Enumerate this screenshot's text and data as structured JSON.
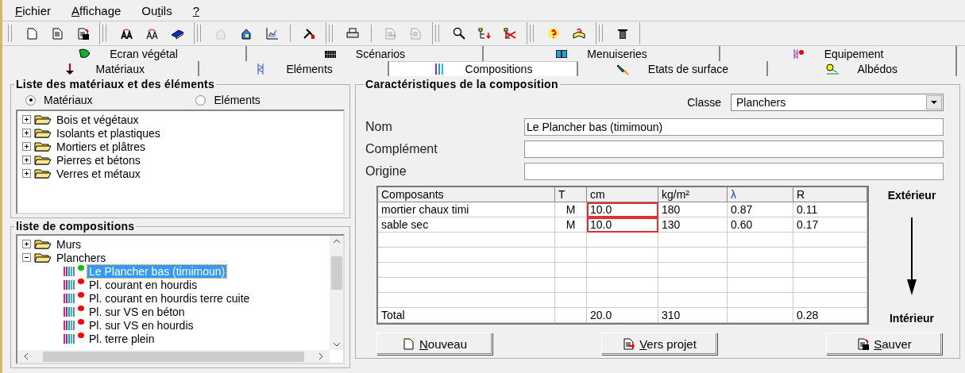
{
  "menu": [
    {
      "key": "F",
      "post": "ichier"
    },
    {
      "key": "A",
      "post": "ffichage"
    },
    {
      "pre": "Ou",
      "key": "t",
      "post": "ils"
    },
    {
      "key": "?"
    }
  ],
  "toolbar": [
    [
      [
        {
          "kind": "new",
          "disabled": false
        },
        {
          "kind": "list",
          "disabled": false
        },
        {
          "kind": "save",
          "disabled": false
        }
      ]
    ],
    [
      [
        {
          "kind": "font-red",
          "disabled": false
        },
        {
          "kind": "font",
          "disabled": false
        },
        {
          "kind": "book",
          "disabled": false
        }
      ]
    ],
    [
      [
        {
          "kind": "house",
          "disabled": true
        },
        {
          "kind": "house-blue",
          "disabled": false
        },
        {
          "kind": "chart",
          "disabled": false
        }
      ],
      [
        {
          "kind": "tools",
          "disabled": false
        }
      ]
    ],
    [
      [
        {
          "kind": "print",
          "disabled": false
        }
      ],
      [
        {
          "kind": "export",
          "disabled": true
        },
        {
          "kind": "import",
          "disabled": true
        }
      ]
    ],
    [
      [
        {
          "kind": "search",
          "disabled": false
        },
        {
          "kind": "tree-down",
          "disabled": false
        },
        {
          "kind": "tree-x",
          "disabled": false
        }
      ]
    ],
    [
      [
        {
          "kind": "help",
          "disabled": false
        },
        {
          "kind": "help-book",
          "disabled": false
        }
      ]
    ],
    [
      [
        {
          "kind": "trash",
          "disabled": false
        }
      ]
    ]
  ],
  "tabs_row_1": [
    {
      "label": "Ecran végétal",
      "kind": "leaf",
      "selected": false
    },
    {
      "label": "Scénarios",
      "kind": "grid",
      "selected": false
    },
    {
      "label": "Menuiseries",
      "kind": "window",
      "selected": false
    },
    {
      "label": "Equipement",
      "kind": "equip",
      "selected": false
    }
  ],
  "tabs_row_2": [
    {
      "label": "Matériaux",
      "kind": "trowel",
      "selected": false
    },
    {
      "label": "Eléments",
      "kind": "wall",
      "selected": false
    },
    {
      "label": "Compositions",
      "kind": "layers",
      "selected": true
    },
    {
      "label": "Etats de surface",
      "kind": "brush",
      "selected": false
    },
    {
      "label": "Albédos",
      "kind": "sun",
      "selected": false
    }
  ],
  "materials_panel": {
    "title": "Liste des matériaux et des éléments",
    "radios": [
      {
        "label": "Matériaux",
        "selected": true
      },
      {
        "label": "Eléments",
        "selected": false
      }
    ],
    "tree": [
      {
        "label": "Bois et végétaux",
        "expanded": false
      },
      {
        "label": "Isolants et plastiques",
        "expanded": false
      },
      {
        "label": "Mortiers et plâtres",
        "expanded": false
      },
      {
        "label": "Pierres et bétons",
        "expanded": false
      },
      {
        "label": "Verres et métaux",
        "expanded": false
      }
    ]
  },
  "compositions_panel": {
    "title": "liste de compositions",
    "tree": [
      {
        "label": "Murs",
        "expanded": false
      },
      {
        "label": "Planchers",
        "expanded": true,
        "children": [
          {
            "label": "Le Plancher bas (timimoun)",
            "color": "#00c000",
            "selected": true
          },
          {
            "label": "Pl. courant en hourdis",
            "color": "#ff0000",
            "selected": false
          },
          {
            "label": "Pl. courant en hourdis terre cuite",
            "color": "#ff0000",
            "selected": false
          },
          {
            "label": "Pl. sur VS en béton",
            "color": "#ff0000",
            "selected": false
          },
          {
            "label": "Pl. sur VS en hourdis",
            "color": "#ff0000",
            "selected": false
          },
          {
            "label": "Pl. terre plein",
            "color": "#ff0000",
            "selected": false
          }
        ]
      }
    ]
  },
  "characteristics": {
    "title": "Caractéristiques de la composition",
    "classe": {
      "label": "Classe",
      "value": "Planchers"
    },
    "fields": [
      {
        "label": "Nom",
        "value": "Le Plancher bas (timimoun)"
      },
      {
        "label": "Complément"
      },
      {
        "label": "Origine"
      }
    ],
    "table": {
      "columns": [
        "Composants",
        "T",
        "cm",
        "kg/m²",
        "λ",
        "R"
      ],
      "rows": [
        {
          "kind": "layer",
          "cells": [
            "mortier chaux timi",
            "M",
            "10.0",
            "180",
            "0.87",
            "0.11"
          ],
          "flagged": true
        },
        {
          "kind": "layer",
          "cells": [
            "sable sec",
            "M",
            "10.0",
            "130",
            "0.60",
            "0.17"
          ],
          "flagged": true
        },
        {
          "kind": "total",
          "cells": [
            "Total",
            "",
            "20.0",
            "310",
            "",
            "0.28"
          ],
          "flagged": false
        }
      ]
    },
    "top_label": "Extérieur",
    "bottom_label": "Intérieur",
    "buttons": [
      {
        "key": "N",
        "post": "ouveau",
        "kind": "new"
      },
      {
        "key": "V",
        "post": "ers projet",
        "kind": "export"
      },
      {
        "key": "S",
        "post": "auver",
        "kind": "save"
      }
    ]
  }
}
